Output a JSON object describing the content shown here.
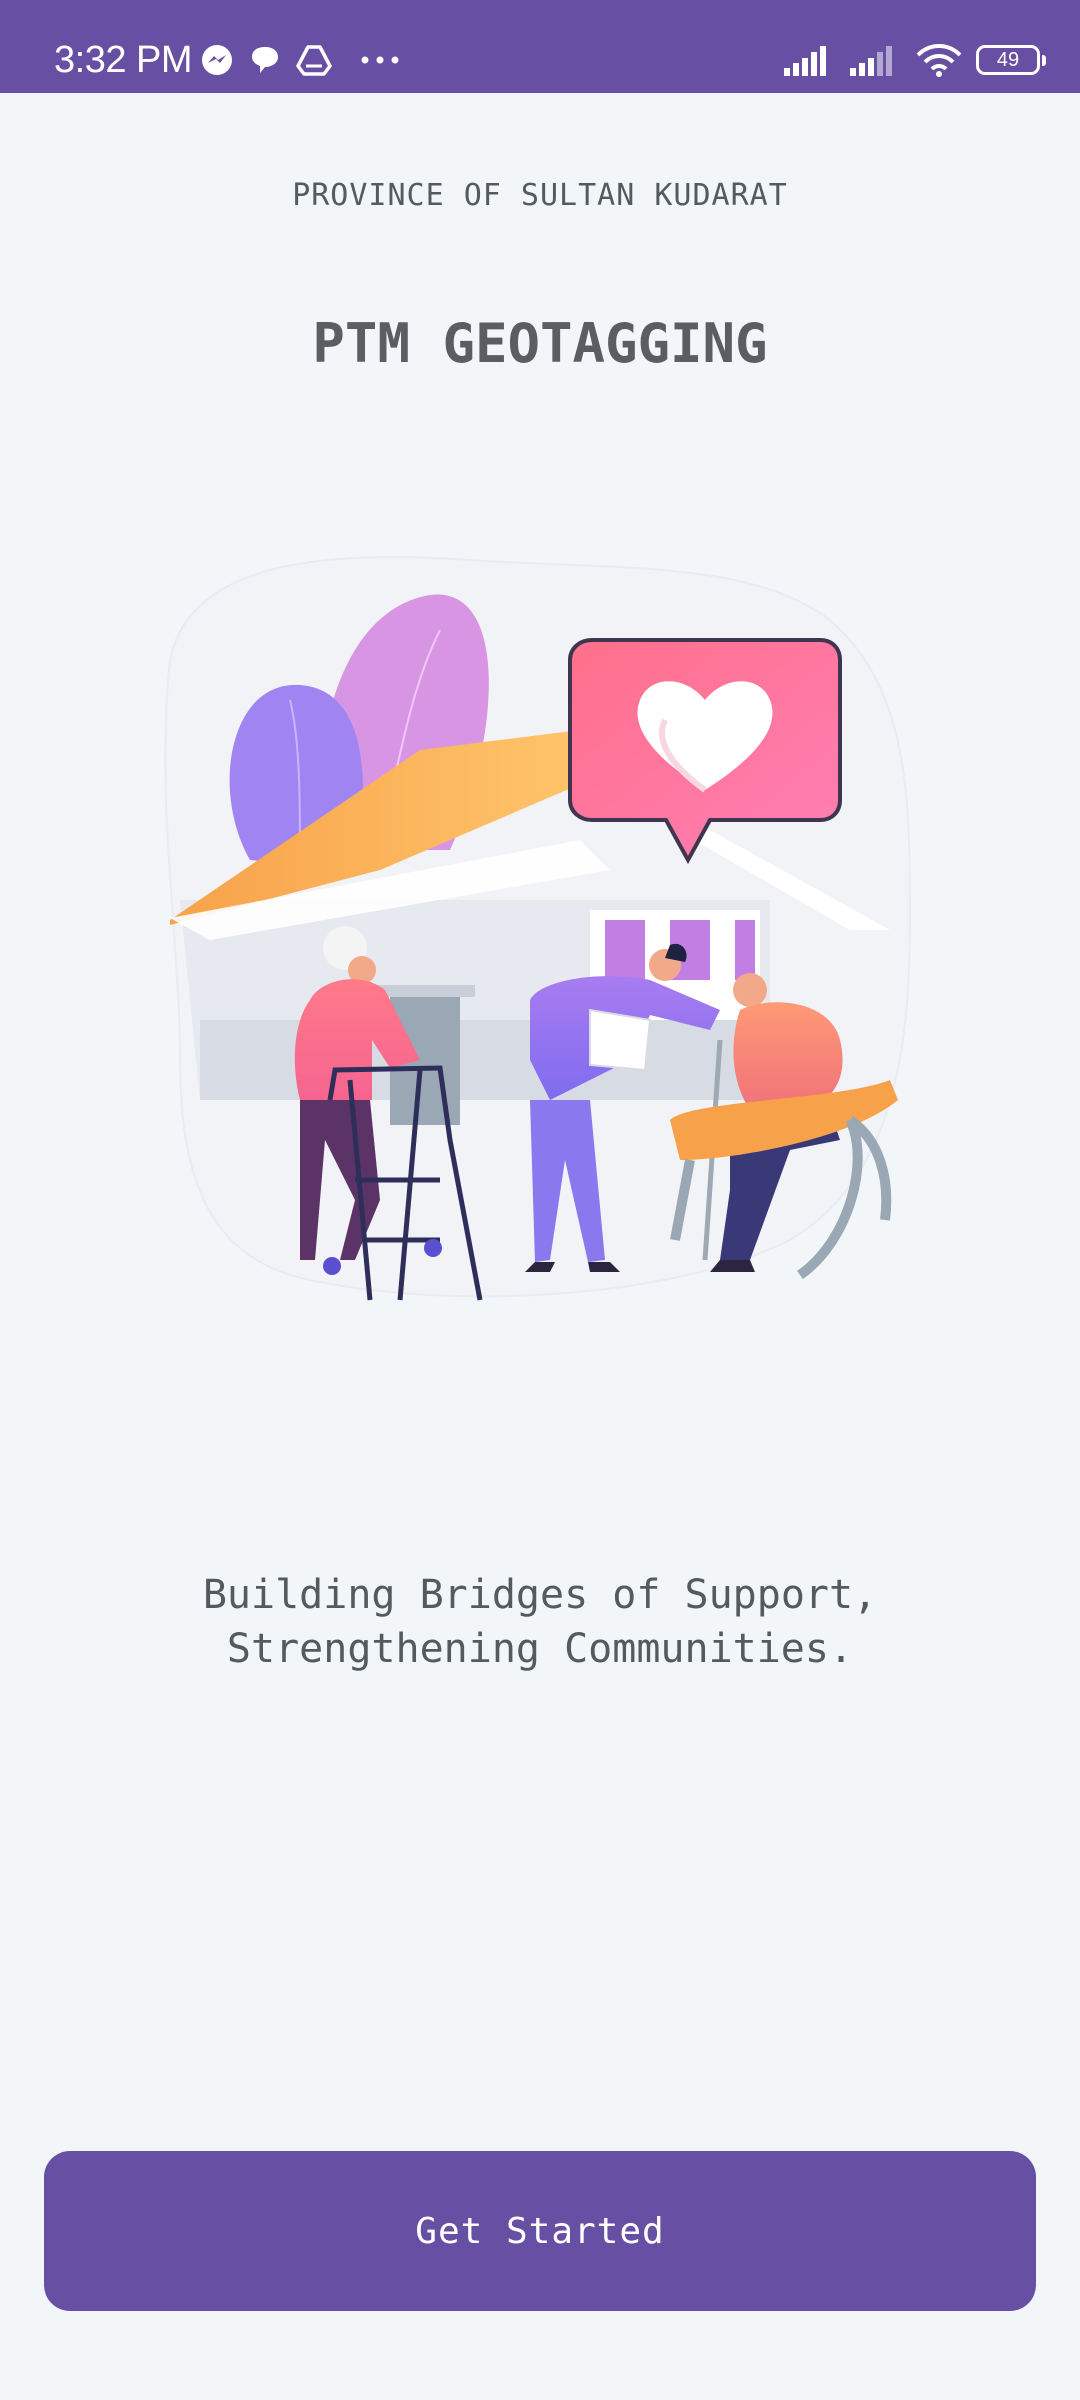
{
  "status_bar": {
    "time": "3:32 PM",
    "notification_icons": [
      "messenger-icon",
      "chat-bubble-icon",
      "drive-icon",
      "more-dots-icon"
    ],
    "system_icons": [
      "signal-icon",
      "signal-icon",
      "wifi-icon"
    ],
    "battery_level": "49",
    "background": "#6750a4"
  },
  "header": {
    "province": "PROVINCE OF SULTAN KUDARAT",
    "title": "PTM GEOTAGGING"
  },
  "illustration": {
    "icon": "community-care-illustration"
  },
  "tagline": {
    "line1": "Building Bridges of Support,",
    "line2": "Strengthening Communities."
  },
  "cta": {
    "label": "Get Started",
    "color": "#6750a4"
  }
}
